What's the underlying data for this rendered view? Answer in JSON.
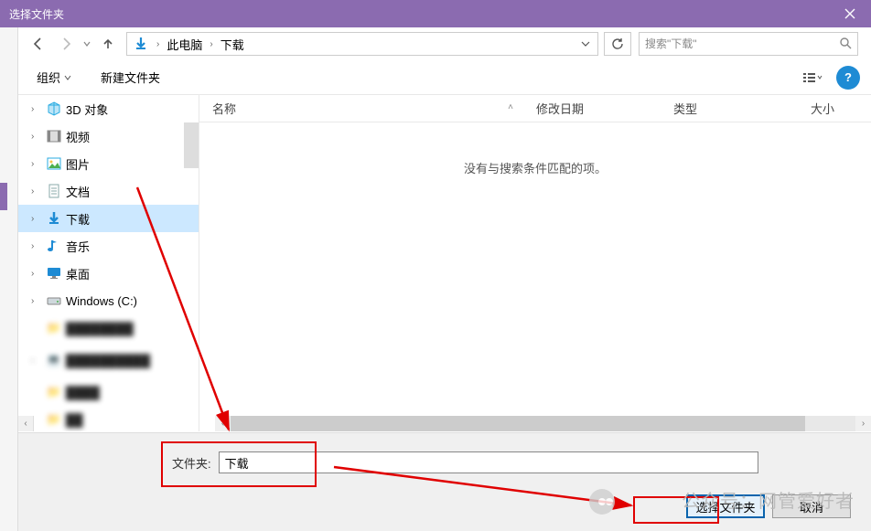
{
  "title": "选择文件夹",
  "breadcrumb": {
    "icon": "download",
    "seg1": "此电脑",
    "seg2": "下载"
  },
  "search": {
    "placeholder": "搜索\"下载\""
  },
  "toolbar": {
    "organize": "组织",
    "newfolder": "新建文件夹"
  },
  "tree": [
    {
      "label": "3D 对象",
      "icon": "cube",
      "color": "#29abe2"
    },
    {
      "label": "视频",
      "icon": "film",
      "color": "#666"
    },
    {
      "label": "图片",
      "icon": "pict",
      "color": "#29abe2"
    },
    {
      "label": "文档",
      "icon": "doc",
      "color": "#8aa"
    },
    {
      "label": "下载",
      "icon": "dl",
      "color": "#1e8bd4",
      "selected": true
    },
    {
      "label": "音乐",
      "icon": "music",
      "color": "#1e8bd4"
    },
    {
      "label": "桌面",
      "icon": "desk",
      "color": "#1e8bd4"
    },
    {
      "label": "Windows (C:)",
      "icon": "drive",
      "color": "#9aa9b8"
    }
  ],
  "columns": {
    "name": "名称",
    "date": "修改日期",
    "type": "类型",
    "size": "大小"
  },
  "empty_text": "没有与搜索条件匹配的项。",
  "folder_label": "文件夹:",
  "folder_value": "下载",
  "buttons": {
    "select": "选择文件夹",
    "cancel": "取消"
  },
  "watermark": "公众号：网管爱好者"
}
